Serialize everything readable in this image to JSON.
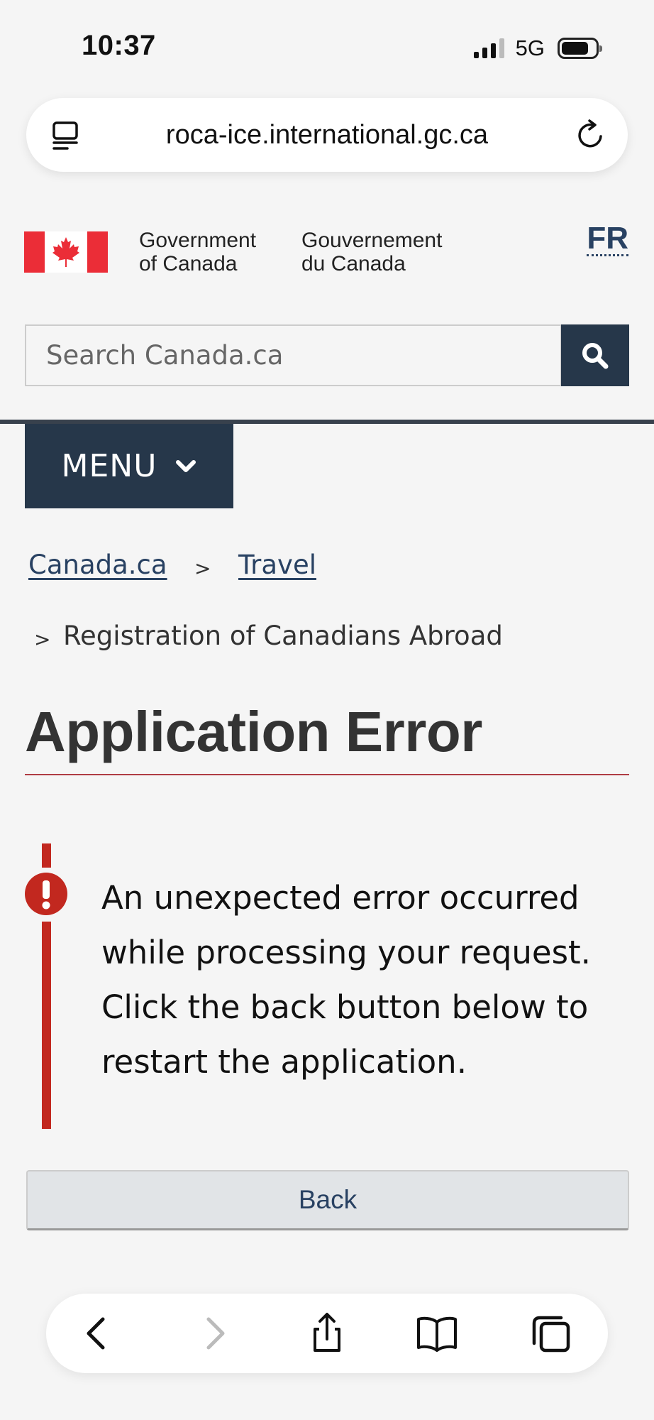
{
  "status_bar": {
    "time": "10:37",
    "network": "5G"
  },
  "browser": {
    "url": "roca-ice.international.gc.ca"
  },
  "header": {
    "gov_en_line1": "Government",
    "gov_en_line2": "of Canada",
    "gov_fr_line1": "Gouvernement",
    "gov_fr_line2": "du Canada",
    "language_toggle": "FR"
  },
  "search": {
    "placeholder": "Search Canada.ca"
  },
  "menu": {
    "label": "MENU"
  },
  "breadcrumbs": {
    "items": [
      {
        "label": "Canada.ca"
      },
      {
        "label": "Travel"
      }
    ],
    "separator": ">",
    "current": "Registration of Canadians Abroad"
  },
  "main": {
    "title": "Application Error",
    "alert_message": "An unexpected error occurred while processing your request. Click the back button below to restart the application.",
    "back_label": "Back"
  },
  "toolbar": {
    "icons": [
      "back-icon",
      "forward-icon",
      "share-icon",
      "bookmarks-icon",
      "tabs-icon"
    ]
  },
  "colors": {
    "navy": "#26374a",
    "link": "#284162",
    "alert_red": "#c2281f",
    "flag_red": "#eb2d37"
  }
}
